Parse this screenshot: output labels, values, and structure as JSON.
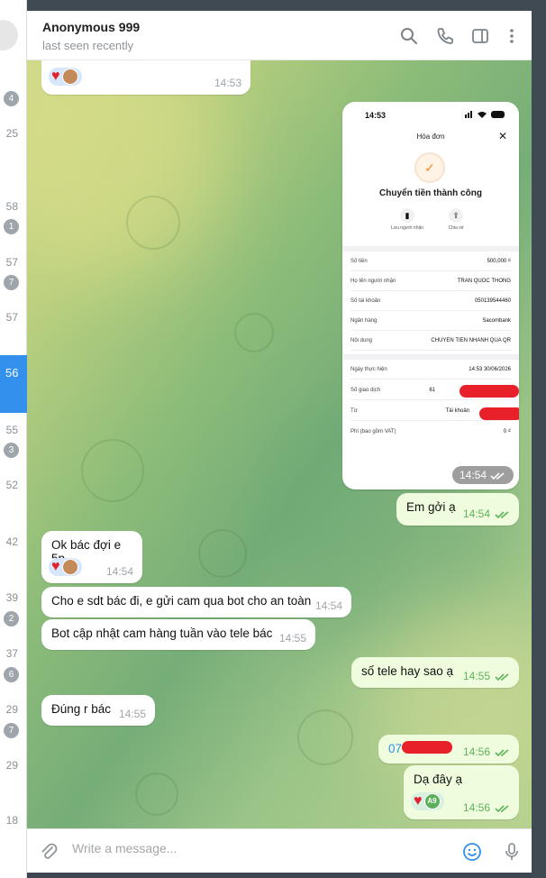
{
  "header": {
    "title": "Anonymous 999",
    "status": "last seen recently"
  },
  "left_list": {
    "numbers": [
      "4",
      "25",
      "58",
      "1",
      "57",
      "7",
      "57",
      "56",
      "55",
      "3",
      "52",
      "42",
      "39",
      "2",
      "37",
      "6",
      "29",
      "7",
      "29",
      "18"
    ]
  },
  "messages": {
    "m0": {
      "time": "14:53"
    },
    "receipt": {
      "status_time": "14:53",
      "title": "Hóa đơn",
      "close": "✕",
      "success": "Chuyển tiền thành công",
      "action1": "Lưu người nhận",
      "action2": "Chia sẻ",
      "rows1": [
        {
          "k": "Số tiền",
          "v": "500,000 ₫"
        },
        {
          "k": "Họ tên người nhận",
          "v": "TRAN QUOC THONG"
        },
        {
          "k": "Số tài khoản",
          "v": "050139544460"
        },
        {
          "k": "Ngân hàng",
          "v": "Sacombank"
        },
        {
          "k": "Nội dung",
          "v": "CHUYEN TIEN NHANH QUA QR"
        }
      ],
      "rows2": [
        {
          "k": "Ngày thực hiện",
          "v": "14:53 30/06/2026"
        },
        {
          "k": "Số giao dịch",
          "v": "61"
        },
        {
          "k": "Từ",
          "v": "Tài khoản"
        },
        {
          "k": "Phí (bao gồm VAT)",
          "v": "0 ₫"
        }
      ],
      "time": "14:54"
    },
    "m1": {
      "text": "Em gởi ạ",
      "time": "14:54"
    },
    "m2": {
      "text": "Ok bác đợi e 5p",
      "time": "14:54"
    },
    "m3": {
      "text": "Cho e sdt bác đi, e gửi cam qua bot cho an toàn",
      "time": "14:54"
    },
    "m4": {
      "text": "Bot cập nhật cam hàng tuần vào tele bác",
      "time": "14:55"
    },
    "m5": {
      "text": "số tele hay sao ạ",
      "time": "14:55"
    },
    "m6": {
      "text": "Đúng r bác",
      "time": "14:55"
    },
    "m7": {
      "text": "07",
      "time": "14:56"
    },
    "m8": {
      "text": "Dạ đây ạ",
      "time": "14:56",
      "avatar": "A9"
    }
  },
  "input": {
    "placeholder": "Write a message..."
  },
  "colors": {
    "accent": "#3390ec",
    "outgoing": "#effdde",
    "redaction": "#e8202a",
    "check": "#5fb15a"
  }
}
